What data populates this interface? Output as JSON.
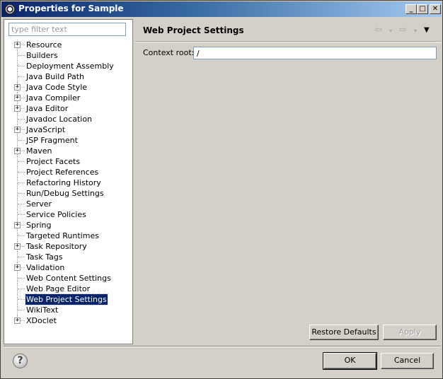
{
  "window": {
    "title": "Properties for Sample",
    "min_glyph": "_",
    "max_glyph": "□",
    "close_glyph": "✕"
  },
  "sidebar": {
    "filter_placeholder": "type filter text",
    "items": [
      {
        "label": "Resource",
        "expandable": true
      },
      {
        "label": "Builders",
        "expandable": false
      },
      {
        "label": "Deployment Assembly",
        "expandable": false
      },
      {
        "label": "Java Build Path",
        "expandable": false
      },
      {
        "label": "Java Code Style",
        "expandable": true
      },
      {
        "label": "Java Compiler",
        "expandable": true
      },
      {
        "label": "Java Editor",
        "expandable": true
      },
      {
        "label": "Javadoc Location",
        "expandable": false
      },
      {
        "label": "JavaScript",
        "expandable": true
      },
      {
        "label": "JSP Fragment",
        "expandable": false
      },
      {
        "label": "Maven",
        "expandable": true
      },
      {
        "label": "Project Facets",
        "expandable": false
      },
      {
        "label": "Project References",
        "expandable": false
      },
      {
        "label": "Refactoring History",
        "expandable": false
      },
      {
        "label": "Run/Debug Settings",
        "expandable": false
      },
      {
        "label": "Server",
        "expandable": false
      },
      {
        "label": "Service Policies",
        "expandable": false
      },
      {
        "label": "Spring",
        "expandable": true
      },
      {
        "label": "Targeted Runtimes",
        "expandable": false
      },
      {
        "label": "Task Repository",
        "expandable": true
      },
      {
        "label": "Task Tags",
        "expandable": false
      },
      {
        "label": "Validation",
        "expandable": true
      },
      {
        "label": "Web Content Settings",
        "expandable": false
      },
      {
        "label": "Web Page Editor",
        "expandable": false
      },
      {
        "label": "Web Project Settings",
        "expandable": false,
        "selected": true
      },
      {
        "label": "WikiText",
        "expandable": false
      },
      {
        "label": "XDoclet",
        "expandable": true
      }
    ]
  },
  "main": {
    "title": "Web Project Settings",
    "nav": {
      "back": "⇦",
      "forward": "⇨",
      "dropdown": "▾",
      "menu": "▼"
    },
    "context_root_label": "Context root:",
    "context_root_value": "/",
    "restore_defaults_label": "Restore Defaults",
    "apply_label": "Apply"
  },
  "footer": {
    "help_glyph": "?",
    "ok_label": "OK",
    "cancel_label": "Cancel"
  }
}
